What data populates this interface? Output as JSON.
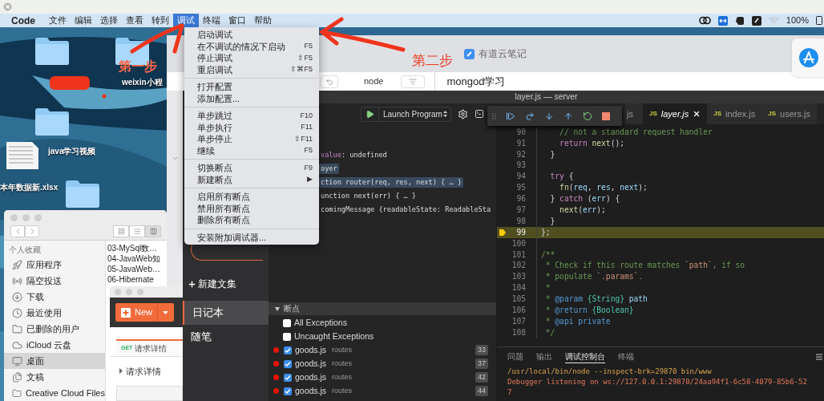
{
  "menu_bar": {
    "app": "Code",
    "items": [
      {
        "label": "文件",
        "selected": false
      },
      {
        "label": "编辑",
        "selected": false
      },
      {
        "label": "选择",
        "selected": false
      },
      {
        "label": "查看",
        "selected": false
      },
      {
        "label": "转到",
        "selected": false
      },
      {
        "label": "调试",
        "selected": true
      },
      {
        "label": "终端",
        "selected": false
      },
      {
        "label": "窗口",
        "selected": false
      },
      {
        "label": "帮助",
        "selected": false
      }
    ],
    "battery": "100%"
  },
  "debug_menu": {
    "groups": [
      [
        {
          "label": "启动调试"
        },
        {
          "label": "在不调试的情况下启动",
          "shortcut": "F5"
        },
        {
          "label": "停止调试",
          "shortcut": "⇧F5"
        },
        {
          "label": "重启调试",
          "shortcut": "⇧⌘F5"
        }
      ],
      [
        {
          "label": "打开配置"
        },
        {
          "label": "添加配置..."
        }
      ],
      [
        {
          "label": "单步跳过",
          "shortcut": "F10"
        },
        {
          "label": "单步执行",
          "shortcut": "F11"
        },
        {
          "label": "单步停止",
          "shortcut": "⇧F11"
        },
        {
          "label": "继续",
          "shortcut": "F5"
        }
      ],
      [
        {
          "label": "切换断点",
          "shortcut": "F9"
        },
        {
          "label": "新建断点",
          "shortcut": "▶"
        }
      ],
      [
        {
          "label": "启用所有断点"
        },
        {
          "label": "禁用所有断点"
        },
        {
          "label": "删除所有断点"
        }
      ],
      [
        {
          "label": "安装附加调试器..."
        }
      ]
    ]
  },
  "annotations": [
    "第一步",
    "第二步"
  ],
  "desktop": {
    "icons": [
      {
        "kind": "folder"
      },
      {
        "kind": "folder",
        "label": "weixin小程"
      },
      {
        "kind": "folder",
        "label": "java学习视频"
      },
      {
        "kind": "spreadsheet",
        "label": "本年数据新.xlsx"
      },
      {
        "kind": "folder"
      }
    ]
  },
  "youdao": {
    "title": "有道云笔记",
    "notebook": "node",
    "note_title": "mongod学习",
    "new_collection": "新建文集",
    "items": [
      {
        "label": "日记本",
        "selected": true
      },
      {
        "label": "随笔",
        "selected": false
      }
    ]
  },
  "finder": {
    "section": "个人收藏",
    "items": [
      {
        "label": "应用程序",
        "selected": false
      },
      {
        "label": "隔空投送",
        "selected": false
      },
      {
        "label": "下载",
        "selected": false
      },
      {
        "label": "最近使用",
        "selected": false
      },
      {
        "label": "已删除的用户",
        "selected": false
      },
      {
        "label": "iCloud 云盘",
        "selected": false
      },
      {
        "label": "桌面",
        "selected": true
      },
      {
        "label": "文稿",
        "selected": false
      },
      {
        "label": "Creative Cloud Files",
        "selected": false
      }
    ],
    "files": [
      "03-MySql数…",
      "04-JavaWeb知",
      "05-JavaWeb…",
      "06-Hibernate"
    ]
  },
  "postman": {
    "new_button": "New",
    "tab": {
      "method": "GET",
      "label": "请求详情"
    },
    "section": "请求详情"
  },
  "vscode": {
    "title": "layer.js — server",
    "launch_config": "Launch Program",
    "tabs": [
      {
        "name": "js",
        "selected": false
      },
      {
        "name": "layer.js",
        "badge": "JS",
        "selected": true
      },
      {
        "name": "index.js",
        "badge": "JS",
        "selected": false
      },
      {
        "name": "users.js",
        "badge": "JS",
        "selected": false
      }
    ],
    "variables": [
      {
        "kind": "pair",
        "name": "value",
        "value": ": undefined",
        "highlighted": false
      },
      {
        "kind": "text",
        "text": "ayer",
        "highlighted": true
      },
      {
        "kind": "text",
        "text": "ction router(req, res, next) { … }",
        "highlighted": true
      },
      {
        "kind": "text",
        "text": "unction next(err) { … }",
        "highlighted": false
      },
      {
        "kind": "text",
        "text": "comingMessage {readableState: ReadableSta",
        "highlighted": false
      }
    ],
    "breakpoints": {
      "title": "断点",
      "expanded": true,
      "exceptions": [
        {
          "label": "All Exceptions",
          "checked": false
        },
        {
          "label": "Uncaught Exceptions",
          "checked": false
        }
      ],
      "items": [
        {
          "file": "goods.js",
          "folder": "routes",
          "line": "33",
          "checked": true
        },
        {
          "file": "goods.js",
          "folder": "routes",
          "line": "37",
          "checked": true
        },
        {
          "file": "goods.js",
          "folder": "routes",
          "line": "42",
          "checked": true
        },
        {
          "file": "goods.js",
          "folder": "routes",
          "line": "44",
          "checked": true
        }
      ]
    },
    "editor": {
      "lines": [
        {
          "number": "90",
          "current": false,
          "tokens": [
            {
              "kind": "comment",
              "text": "    // not a standard request handler"
            }
          ]
        },
        {
          "number": "91",
          "current": false,
          "tokens": [
            {
              "kind": "keyword",
              "text": "    return"
            },
            {
              "kind": "fn",
              "text": " next"
            },
            {
              "kind": "plain",
              "text": "();"
            }
          ]
        },
        {
          "number": "92",
          "current": false,
          "tokens": [
            {
              "kind": "plain",
              "text": "  }"
            }
          ]
        },
        {
          "number": "93",
          "current": false
        },
        {
          "number": "94",
          "current": false,
          "tokens": [
            {
              "kind": "keyword",
              "text": "  try"
            },
            {
              "kind": "plain",
              "text": " {"
            }
          ]
        },
        {
          "number": "95",
          "current": false,
          "tokens": [
            {
              "kind": "fn",
              "text": "    fn"
            },
            {
              "kind": "plain",
              "text": "("
            },
            {
              "kind": "var",
              "text": "req"
            },
            {
              "kind": "plain",
              "text": ", "
            },
            {
              "kind": "var",
              "text": "res"
            },
            {
              "kind": "plain",
              "text": ", "
            },
            {
              "kind": "var",
              "text": "next"
            },
            {
              "kind": "plain",
              "text": ");"
            }
          ]
        },
        {
          "number": "96",
          "current": false,
          "tokens": [
            {
              "kind": "plain",
              "text": "  } "
            },
            {
              "kind": "keyword",
              "text": "catch"
            },
            {
              "kind": "plain",
              "text": " ("
            },
            {
              "kind": "var",
              "text": "err"
            },
            {
              "kind": "plain",
              "text": ") {"
            }
          ]
        },
        {
          "number": "97",
          "current": false,
          "tokens": [
            {
              "kind": "fn",
              "text": "    next"
            },
            {
              "kind": "plain",
              "text": "("
            },
            {
              "kind": "var",
              "text": "err"
            },
            {
              "kind": "plain",
              "text": ");"
            }
          ]
        },
        {
          "number": "98",
          "current": false,
          "tokens": [
            {
              "kind": "plain",
              "text": "  }"
            }
          ]
        },
        {
          "number": "99",
          "current": true,
          "tokens": [
            {
              "kind": "plain",
              "text": "};"
            }
          ]
        },
        {
          "number": "100",
          "current": false
        },
        {
          "number": "101",
          "current": false,
          "tokens": [
            {
              "kind": "comment",
              "text": "/**"
            }
          ]
        },
        {
          "number": "102",
          "current": false,
          "tokens": [
            {
              "kind": "comment",
              "text": " * Check if this route matches "
            },
            {
              "kind": "string",
              "text": "`path`"
            },
            {
              "kind": "comment",
              "text": ", if so"
            }
          ]
        },
        {
          "number": "103",
          "current": false,
          "tokens": [
            {
              "kind": "comment",
              "text": " * populate "
            },
            {
              "kind": "string",
              "text": "`.params`"
            },
            {
              "kind": "comment",
              "text": "."
            }
          ]
        },
        {
          "number": "104",
          "current": false,
          "tokens": [
            {
              "kind": "comment",
              "text": " *"
            }
          ]
        },
        {
          "number": "105",
          "current": false,
          "tokens": [
            {
              "kind": "comment",
              "text": " * "
            },
            {
              "kind": "tag",
              "text": "@param"
            },
            {
              "kind": "type",
              "text": " {String}"
            },
            {
              "kind": "var",
              "text": " path"
            }
          ]
        },
        {
          "number": "106",
          "current": false,
          "tokens": [
            {
              "kind": "comment",
              "text": " * "
            },
            {
              "kind": "tag",
              "text": "@return"
            },
            {
              "kind": "type",
              "text": " {Boolean}"
            }
          ]
        },
        {
          "number": "107",
          "current": false,
          "tokens": [
            {
              "kind": "comment",
              "text": " * "
            },
            {
              "kind": "tag",
              "text": "@api private"
            }
          ]
        },
        {
          "number": "108",
          "current": false,
          "tokens": [
            {
              "kind": "comment",
              "text": " */"
            }
          ]
        }
      ]
    },
    "panel": {
      "tabs": [
        {
          "label": "问题",
          "selected": false
        },
        {
          "label": "输出",
          "selected": false
        },
        {
          "label": "调试控制台",
          "selected": true
        },
        {
          "label": "终端",
          "selected": false
        }
      ],
      "output": [
        {
          "kind": "command",
          "text": "/usr/local/bin/node --inspect-brk=29870 bin/www"
        },
        {
          "kind": "info",
          "text": "Debugger listening on ws://127.0.0.1:29870/24aa94f1-6c58-4079-85b6-52"
        },
        {
          "kind": "info",
          "text": "7"
        }
      ]
    }
  }
}
